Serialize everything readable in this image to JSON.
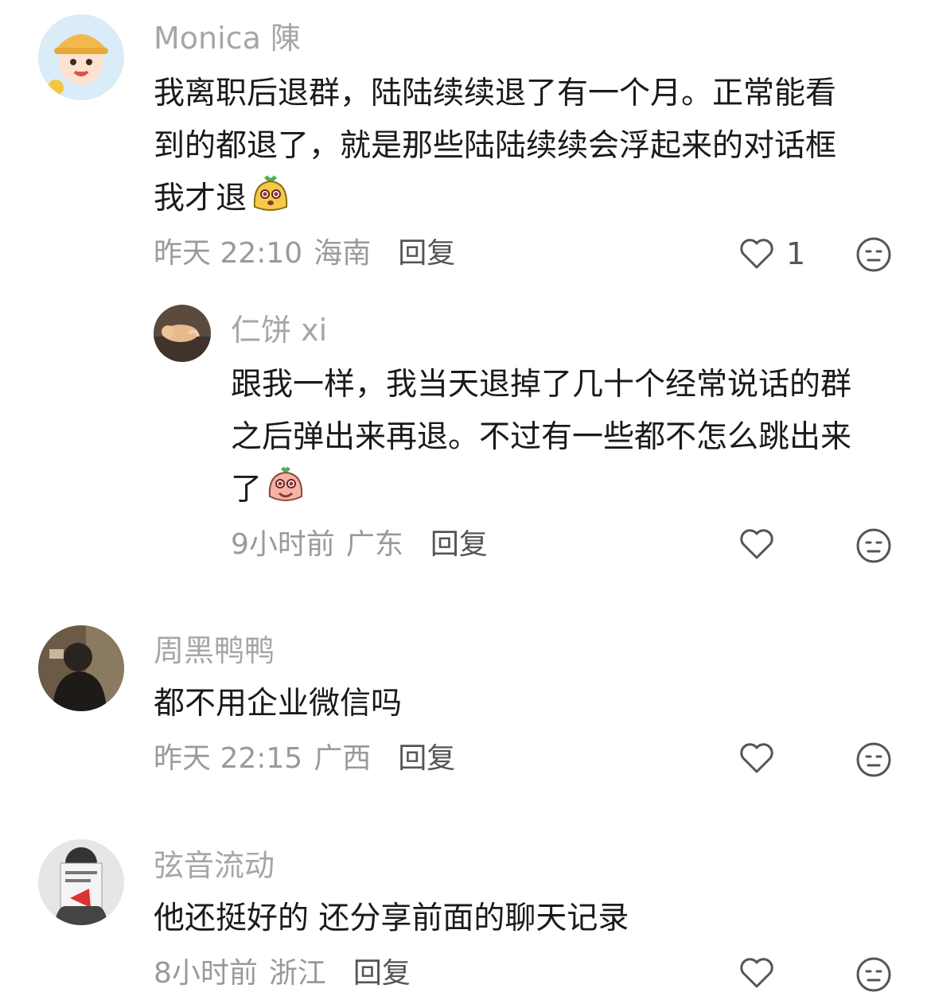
{
  "comments": [
    {
      "name": "Monica 陳",
      "lines": [
        "我离职后退群，陆陆续续退了有一个月。正常能看",
        "到的都退了，就是那些陆陆续续会浮起来的对话框",
        "我才退"
      ],
      "time": "昨天 22:10",
      "location": "海南",
      "reply_label": "回复",
      "likes": "1",
      "avatar_icon": "cartoon-kid-avatar",
      "reply": {
        "name": "仁饼 xi",
        "lines": [
          "跟我一样，我当天退掉了几十个经常说话的群",
          "之后弹出来再退。不过有一些都不怎么跳出来",
          "了"
        ],
        "time": "9小时前",
        "location": "广东",
        "reply_label": "回复",
        "avatar_icon": "cat-photo-avatar"
      }
    },
    {
      "name": "周黑鸭鸭",
      "lines": [
        "都不用企业微信吗"
      ],
      "time": "昨天 22:15",
      "location": "广西",
      "reply_label": "回复",
      "avatar_icon": "person-photo-avatar"
    },
    {
      "name": "弦音流动",
      "lines": [
        "他还挺好的 还分享前面的聊天记录"
      ],
      "time": "8小时前",
      "location": "浙江",
      "reply_label": "回复",
      "avatar_icon": "book-reader-avatar"
    }
  ],
  "colors": {
    "name": "#a6a6a6",
    "text": "#1a1a1a",
    "meta": "#9a9a9a",
    "icon": "#555555"
  }
}
